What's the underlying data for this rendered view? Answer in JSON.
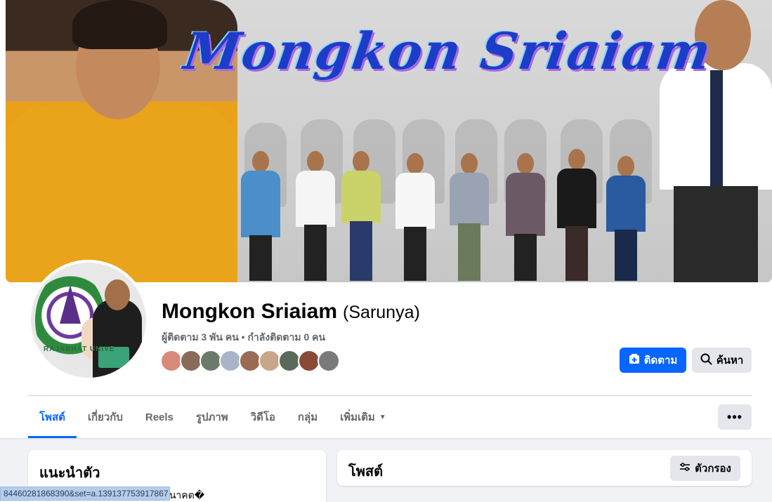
{
  "cover": {
    "title_text": "Mongkon Sriaiam"
  },
  "profile": {
    "name": "Mongkon Sriaiam",
    "alt_name": "(Sarunya)",
    "follow_info": "ผู้ติดตาม 3 พัน คน • กำลังติดตาม 0 คน",
    "avatar_seal_text": "RAJABHAT UNIVE"
  },
  "friend_avatars": [
    "#d88a7a",
    "#8a6b5a",
    "#6b7a6a",
    "#aab4c8",
    "#9a6b55",
    "#c9a58a",
    "#5a6a5a",
    "#8a4a3a",
    "#7a7a7a"
  ],
  "actions": {
    "follow_label": "ติดตาม",
    "search_label": "ค้นหา"
  },
  "tabs": [
    {
      "label": "โพสต์",
      "active": true
    },
    {
      "label": "เกี่ยวกับ",
      "active": false
    },
    {
      "label": "Reels",
      "active": false
    },
    {
      "label": "รูปภาพ",
      "active": false
    },
    {
      "label": "วิดีโอ",
      "active": false
    },
    {
      "label": "กลุ่ม",
      "active": false
    },
    {
      "label": "เพิ่มเติม",
      "active": false
    }
  ],
  "more_label": "•••",
  "intro": {
    "title": "แนะนำตัว",
    "text": "เพื่ออนาคต�"
  },
  "posts": {
    "title": "โพสต์",
    "filter_label": "ตัวกรอง"
  },
  "status_url": "84460281868390&set=a.139137753917867",
  "colors": {
    "primary": "#0866ff",
    "secondary_button": "#e4e6eb",
    "page_bg": "#f0f2f5",
    "muted_text": "#65676b"
  }
}
